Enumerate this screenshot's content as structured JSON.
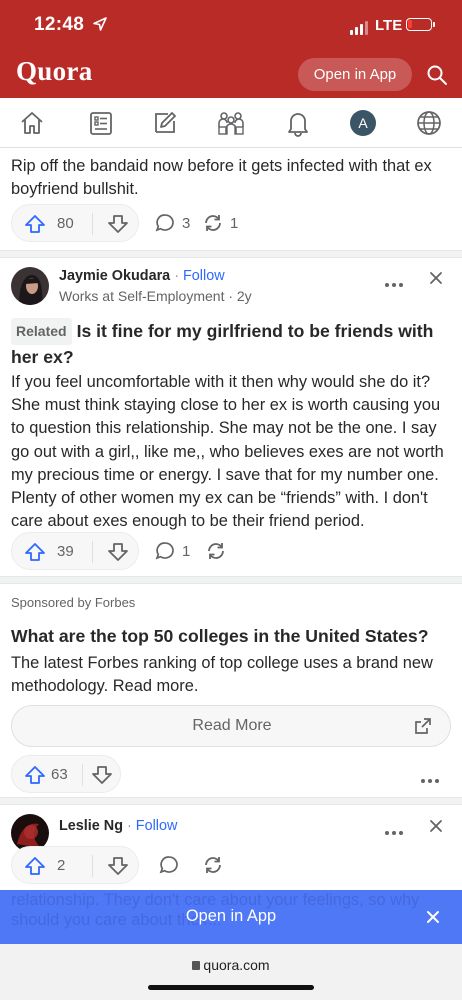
{
  "status_bar": {
    "time": "12:48",
    "network": "LTE"
  },
  "header": {
    "logo": "Quora",
    "open_in_app": "Open in App"
  },
  "nav": {
    "profile_initial": "A"
  },
  "answer_tail": {
    "text": "Rip off the bandaid now before it gets infected with that ex boyfriend bullshit.",
    "upvotes": "80",
    "comments": "3",
    "shares": "1"
  },
  "post1": {
    "author": "Jaymie Okudara",
    "follow": "Follow",
    "credential": "Works at Self-Employment · 2y",
    "related_label": "Related",
    "question": "Is it fine for my girlfriend to be friends with her ex?",
    "body": "If you feel uncomfortable with it then why would she do it? She must think staying close to her ex is worth causing you to question this relationship. She may not be the one. I say go out with a girl,, like me,, who believes exes are not worth my precious time or energy. I save that for my number one. Plenty of other women my ex can be “friends” with. I don't care about exes enough to be their friend period.",
    "upvotes": "39",
    "comments": "1"
  },
  "ad": {
    "sponsor": "Sponsored by Forbes",
    "title": "What are the top 50 colleges in the United States?",
    "text": "The latest Forbes ranking of top college uses a brand new methodology. Read more.",
    "cta": "Read More",
    "upvotes": "63"
  },
  "post2": {
    "author": "Leslie Ng",
    "follow": "Follow",
    "upvotes": "2"
  },
  "banner": {
    "title": "Open in App",
    "ghost_text": "relationship. They don't care about your feelings, so why should you care about their..."
  },
  "browser": {
    "url": "quora.com"
  },
  "colors": {
    "brand": "#b92b27",
    "link": "#2e69ff",
    "banner": "#4f78f7"
  }
}
